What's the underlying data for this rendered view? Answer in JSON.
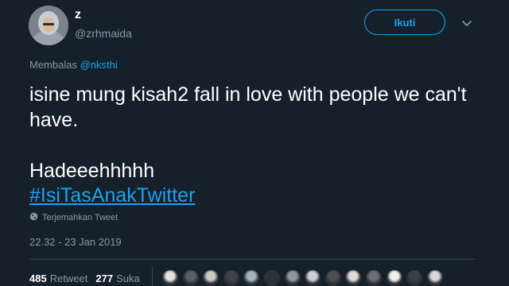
{
  "tweet": {
    "display_name": "z",
    "handle": "@zrhmaida",
    "follow_label": "Ikuti",
    "reply_prefix": "Membalas ",
    "reply_to": "@nksthi",
    "text": "isine mung kisah2 fall in love with people we can't have.\n\nHadeeehhhhh",
    "hashtag": "#IsiTasAnakTwitter",
    "translate_label": "Terjemahkan Tweet",
    "timestamp": "22.32 - 23 Jan 2019",
    "retweet_count": "485",
    "retweet_label": "Retweet",
    "like_count": "277",
    "like_label": "Suka"
  },
  "colors": {
    "background": "#15202b",
    "accent": "#1da1f2",
    "muted": "#8899a6",
    "divider": "#38444d"
  },
  "icons": {
    "menu": "chevron-down-icon",
    "translate": "globe-icon"
  },
  "liker_avatars": [
    {
      "color": "#e8e2dc"
    },
    {
      "color": "#5a5f66"
    },
    {
      "color": "#cfc9c3"
    },
    {
      "color": "#3d4148"
    },
    {
      "color": "#a6b2be"
    },
    {
      "color": "#2e3236"
    },
    {
      "color": "#8e969e"
    },
    {
      "color": "#c9d0d6"
    },
    {
      "color": "#4c5158"
    },
    {
      "color": "#e1dcd6"
    },
    {
      "color": "#6a7076"
    },
    {
      "color": "#f0f0f0"
    },
    {
      "color": "#3a3f45"
    },
    {
      "color": "#d8d8d8"
    }
  ]
}
